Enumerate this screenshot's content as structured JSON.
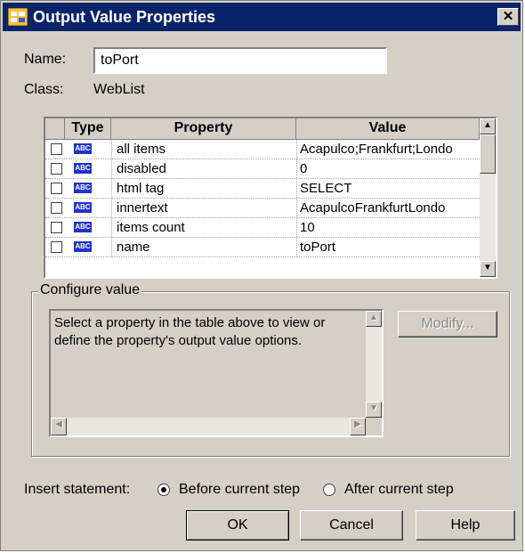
{
  "window": {
    "title": "Output Value Properties",
    "close_symbol": "✕"
  },
  "fields": {
    "name_label": "Name:",
    "name_value": "toPort",
    "class_label": "Class:",
    "class_value": "WebList"
  },
  "table": {
    "headers": {
      "type": "Type",
      "property": "Property",
      "value": "Value"
    },
    "type_badge": "ABC",
    "rows": [
      {
        "property": "all items",
        "value": "Acapulco;Frankfurt;Londo"
      },
      {
        "property": "disabled",
        "value": "0"
      },
      {
        "property": "html tag",
        "value": "SELECT"
      },
      {
        "property": "innertext",
        "value": " AcapulcoFrankfurtLondo"
      },
      {
        "property": "items count",
        "value": "10"
      },
      {
        "property": "name",
        "value": "toPort"
      }
    ]
  },
  "configure": {
    "legend": "Configure value",
    "description": "Select a property in the table above to view or define the property's output value options.",
    "modify_label": "Modify..."
  },
  "insert": {
    "label": "Insert statement:",
    "options": [
      "Before current step",
      "After current step"
    ],
    "selected": "Before current step"
  },
  "buttons": {
    "ok": "OK",
    "cancel": "Cancel",
    "help": "Help"
  },
  "icons": {
    "title_icon": "output-value-icon",
    "type_badge_icon": "string-type-icon"
  },
  "colors": {
    "title_bar": "#0a246a",
    "dialog_bg": "#d4d0c8",
    "badge": "#1f33c8"
  }
}
